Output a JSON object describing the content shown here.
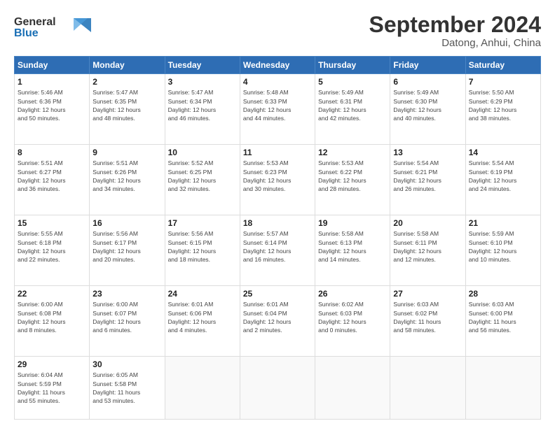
{
  "header": {
    "logo_line1": "General",
    "logo_line2": "Blue",
    "month": "September 2024",
    "location": "Datong, Anhui, China"
  },
  "weekdays": [
    "Sunday",
    "Monday",
    "Tuesday",
    "Wednesday",
    "Thursday",
    "Friday",
    "Saturday"
  ],
  "weeks": [
    [
      {
        "day": "1",
        "info": "Sunrise: 5:46 AM\nSunset: 6:36 PM\nDaylight: 12 hours\nand 50 minutes."
      },
      {
        "day": "2",
        "info": "Sunrise: 5:47 AM\nSunset: 6:35 PM\nDaylight: 12 hours\nand 48 minutes."
      },
      {
        "day": "3",
        "info": "Sunrise: 5:47 AM\nSunset: 6:34 PM\nDaylight: 12 hours\nand 46 minutes."
      },
      {
        "day": "4",
        "info": "Sunrise: 5:48 AM\nSunset: 6:33 PM\nDaylight: 12 hours\nand 44 minutes."
      },
      {
        "day": "5",
        "info": "Sunrise: 5:49 AM\nSunset: 6:31 PM\nDaylight: 12 hours\nand 42 minutes."
      },
      {
        "day": "6",
        "info": "Sunrise: 5:49 AM\nSunset: 6:30 PM\nDaylight: 12 hours\nand 40 minutes."
      },
      {
        "day": "7",
        "info": "Sunrise: 5:50 AM\nSunset: 6:29 PM\nDaylight: 12 hours\nand 38 minutes."
      }
    ],
    [
      {
        "day": "8",
        "info": "Sunrise: 5:51 AM\nSunset: 6:27 PM\nDaylight: 12 hours\nand 36 minutes."
      },
      {
        "day": "9",
        "info": "Sunrise: 5:51 AM\nSunset: 6:26 PM\nDaylight: 12 hours\nand 34 minutes."
      },
      {
        "day": "10",
        "info": "Sunrise: 5:52 AM\nSunset: 6:25 PM\nDaylight: 12 hours\nand 32 minutes."
      },
      {
        "day": "11",
        "info": "Sunrise: 5:53 AM\nSunset: 6:23 PM\nDaylight: 12 hours\nand 30 minutes."
      },
      {
        "day": "12",
        "info": "Sunrise: 5:53 AM\nSunset: 6:22 PM\nDaylight: 12 hours\nand 28 minutes."
      },
      {
        "day": "13",
        "info": "Sunrise: 5:54 AM\nSunset: 6:21 PM\nDaylight: 12 hours\nand 26 minutes."
      },
      {
        "day": "14",
        "info": "Sunrise: 5:54 AM\nSunset: 6:19 PM\nDaylight: 12 hours\nand 24 minutes."
      }
    ],
    [
      {
        "day": "15",
        "info": "Sunrise: 5:55 AM\nSunset: 6:18 PM\nDaylight: 12 hours\nand 22 minutes."
      },
      {
        "day": "16",
        "info": "Sunrise: 5:56 AM\nSunset: 6:17 PM\nDaylight: 12 hours\nand 20 minutes."
      },
      {
        "day": "17",
        "info": "Sunrise: 5:56 AM\nSunset: 6:15 PM\nDaylight: 12 hours\nand 18 minutes."
      },
      {
        "day": "18",
        "info": "Sunrise: 5:57 AM\nSunset: 6:14 PM\nDaylight: 12 hours\nand 16 minutes."
      },
      {
        "day": "19",
        "info": "Sunrise: 5:58 AM\nSunset: 6:13 PM\nDaylight: 12 hours\nand 14 minutes."
      },
      {
        "day": "20",
        "info": "Sunrise: 5:58 AM\nSunset: 6:11 PM\nDaylight: 12 hours\nand 12 minutes."
      },
      {
        "day": "21",
        "info": "Sunrise: 5:59 AM\nSunset: 6:10 PM\nDaylight: 12 hours\nand 10 minutes."
      }
    ],
    [
      {
        "day": "22",
        "info": "Sunrise: 6:00 AM\nSunset: 6:08 PM\nDaylight: 12 hours\nand 8 minutes."
      },
      {
        "day": "23",
        "info": "Sunrise: 6:00 AM\nSunset: 6:07 PM\nDaylight: 12 hours\nand 6 minutes."
      },
      {
        "day": "24",
        "info": "Sunrise: 6:01 AM\nSunset: 6:06 PM\nDaylight: 12 hours\nand 4 minutes."
      },
      {
        "day": "25",
        "info": "Sunrise: 6:01 AM\nSunset: 6:04 PM\nDaylight: 12 hours\nand 2 minutes."
      },
      {
        "day": "26",
        "info": "Sunrise: 6:02 AM\nSunset: 6:03 PM\nDaylight: 12 hours\nand 0 minutes."
      },
      {
        "day": "27",
        "info": "Sunrise: 6:03 AM\nSunset: 6:02 PM\nDaylight: 11 hours\nand 58 minutes."
      },
      {
        "day": "28",
        "info": "Sunrise: 6:03 AM\nSunset: 6:00 PM\nDaylight: 11 hours\nand 56 minutes."
      }
    ],
    [
      {
        "day": "29",
        "info": "Sunrise: 6:04 AM\nSunset: 5:59 PM\nDaylight: 11 hours\nand 55 minutes."
      },
      {
        "day": "30",
        "info": "Sunrise: 6:05 AM\nSunset: 5:58 PM\nDaylight: 11 hours\nand 53 minutes."
      },
      {
        "day": "",
        "info": ""
      },
      {
        "day": "",
        "info": ""
      },
      {
        "day": "",
        "info": ""
      },
      {
        "day": "",
        "info": ""
      },
      {
        "day": "",
        "info": ""
      }
    ]
  ]
}
